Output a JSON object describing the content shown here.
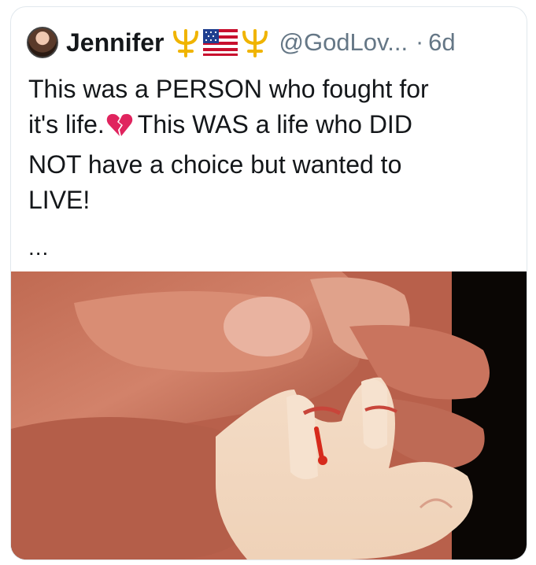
{
  "tweet": {
    "author_name": "Jennifer",
    "name_emojis": [
      "trident-icon",
      "us-flag-icon",
      "trident-icon"
    ],
    "handle": "@GodLov...",
    "separator": "·",
    "timestamp": "6d",
    "text_line1": "This was a PERSON who fought for",
    "text_line2a": "it's life.",
    "text_line2b": "This WAS a life who DID",
    "text_line3": "NOT have a choice but wanted to",
    "text_line4": "LIVE!",
    "inline_emoji": "broken-heart-icon",
    "more_indicator": "..."
  },
  "colors": {
    "text": "#14171a",
    "secondary": "#657786",
    "trident": "#f0b400",
    "border": "#e1e8ed",
    "broken_heart": "#e0245e"
  }
}
